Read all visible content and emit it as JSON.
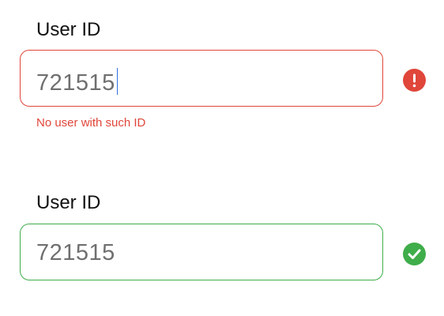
{
  "colors": {
    "error": "#e0463a",
    "success": "#3fad4a",
    "caret": "#2f6fe0",
    "value_text": "#6f6f6f"
  },
  "fields": [
    {
      "label": "User ID",
      "value": "721515",
      "state": "error",
      "has_caret": true,
      "status_icon": "exclamation-icon",
      "error_message": "No user with such ID"
    },
    {
      "label": "User ID",
      "value": "721515",
      "state": "success",
      "has_caret": false,
      "status_icon": "checkmark-icon"
    }
  ]
}
